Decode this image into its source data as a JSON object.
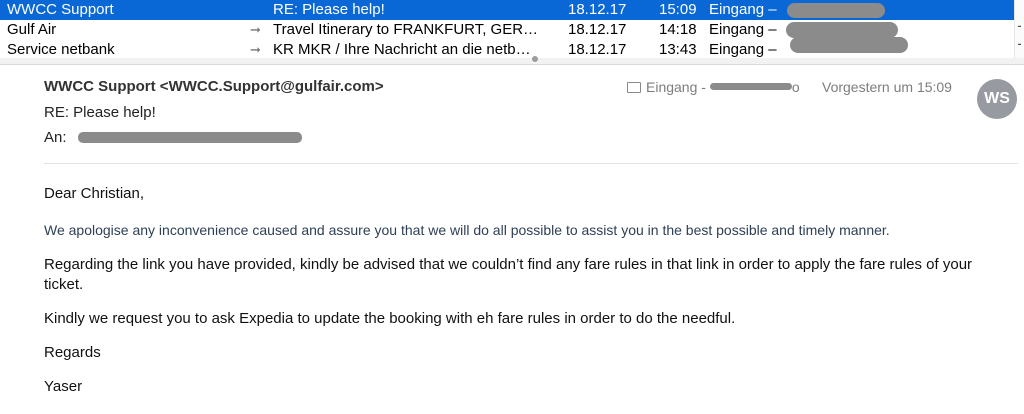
{
  "message_list": [
    {
      "sender": "WWCC Support",
      "subject": "RE: Please help!",
      "date": "18.12.17",
      "time": "15:09",
      "mailbox": "Eingang –",
      "arrow": "",
      "selected": true
    },
    {
      "sender": "Gulf Air",
      "subject": "Travel Itinerary to FRANKFURT, GER…",
      "date": "18.12.17",
      "time": "14:18",
      "mailbox": "Eingang –",
      "arrow": "➞",
      "selected": false
    },
    {
      "sender": "Service netbank",
      "subject": "KR MKR / Ihre Nachricht an die netb…",
      "date": "18.12.17",
      "time": "13:43",
      "mailbox": "Eingang –",
      "arrow": "➞",
      "selected": false
    }
  ],
  "header": {
    "from": "WWCC Support <WWCC.Support@gulfair.com>",
    "subject": "RE: Please help!",
    "to_label": "An:",
    "mailbox_prefix": "Eingang -",
    "mailbox_suffix": "o",
    "date": "Vorgestern um 15:09",
    "avatar_initials": "WS"
  },
  "body": {
    "greeting": "Dear Christian,",
    "para1": "We apologise any inconvenience caused and assure you that we will do all possible to assist you in the best possible and timely manner.",
    "para2": "Regarding the link you have provided, kindly be advised that we couldn’t find any fare rules in that link in order to apply the fare rules of your ticket.",
    "para3": "Kindly we request you to ask Expedia to update the booking with eh fare rules in order to do the needful.",
    "closing": "Regards",
    "signature": "Yaser"
  },
  "colors": {
    "selection": "#0a68d6",
    "avatar": "#989aa2",
    "redaction": "#8b8b8b"
  },
  "icons": {
    "folder": "folder-icon",
    "reply": "reply-arrow-icon"
  }
}
